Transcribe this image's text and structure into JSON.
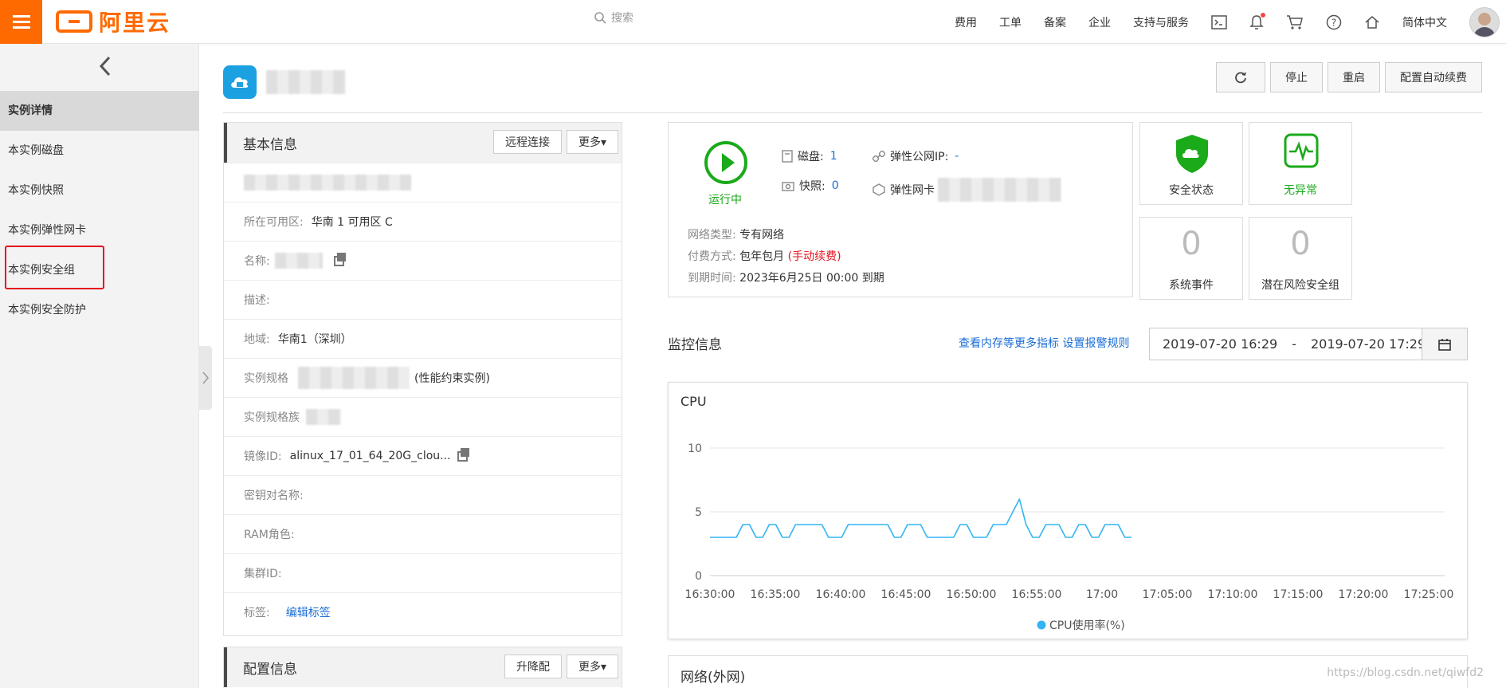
{
  "topbar": {
    "logo_text": "阿里云",
    "search_placeholder": "搜索",
    "nav": [
      "费用",
      "工单",
      "备案",
      "企业",
      "支持与服务"
    ],
    "language": "简体中文"
  },
  "sidebar": {
    "items": [
      {
        "label": "实例详情",
        "active": true
      },
      {
        "label": "本实例磁盘"
      },
      {
        "label": "本实例快照"
      },
      {
        "label": "本实例弹性网卡"
      },
      {
        "label": "本实例安全组"
      },
      {
        "label": "本实例安全防护"
      }
    ]
  },
  "header": {
    "buttons": {
      "stop": "停止",
      "restart": "重启",
      "auto_renew": "配置自动续费"
    }
  },
  "basic": {
    "title": "基本信息",
    "remote": "远程连接",
    "more": "更多▾",
    "zone_label": "所在可用区:",
    "zone": "华南 1 可用区 C",
    "name_label": "名称:",
    "desc_label": "描述:",
    "region_label": "地域:",
    "region": "华南1（深圳）",
    "spec_label": "实例规格",
    "spec_note": "(性能约束实例)",
    "family_label": "实例规格族",
    "image_label": "镜像ID:",
    "image": "alinux_17_01_64_20G_clou...",
    "keypair_label": "密钥对名称:",
    "ram_label": "RAM角色:",
    "cluster_label": "集群ID:",
    "tag_label": "标签:",
    "tag_link": "编辑标签"
  },
  "config": {
    "title": "配置信息",
    "upgrade": "升降配",
    "more": "更多▾"
  },
  "status": {
    "running": "运行中",
    "disk_label": "磁盘:",
    "disk": "1",
    "snapshot_label": "快照:",
    "snapshot": "0",
    "eip_label": "弹性公网IP:",
    "eip": "-",
    "eni_label": "弹性网卡",
    "network_label": "网络类型:",
    "network": "专有网络",
    "billing_label": "付费方式:",
    "billing": "包年包月",
    "billing_note": "(手动续费)",
    "expire_label": "到期时间:",
    "expire": "2023年6月25日 00:00 到期"
  },
  "tiles": {
    "security": "安全状态",
    "no_anomaly": "无异常",
    "events_count": "0",
    "events": "系统事件",
    "risk_count": "0",
    "risk": "潜在风险安全组"
  },
  "monitor": {
    "title": "监控信息",
    "links": "查看内存等更多指标 设置报警规则",
    "range_start": "2019-07-20 16:29",
    "range_sep": "-",
    "range_end": "2019-07-20 17:29",
    "network_title": "网络(外网)"
  },
  "chart_data": {
    "type": "line",
    "title": "CPU",
    "x_ticks": [
      "16:30:00",
      "16:35:00",
      "16:40:00",
      "16:45:00",
      "16:50:00",
      "16:55:00",
      "17:00",
      "17:05:00",
      "17:10:00",
      "17:15:00",
      "17:20:00",
      "17:25:00"
    ],
    "y_ticks": [
      0,
      5,
      10
    ],
    "ylim": [
      0,
      10
    ],
    "series": [
      {
        "name": "CPU使用率(%)",
        "color": "#33b5f4",
        "x": [
          0,
          1,
          2,
          3,
          4,
          5,
          6,
          7,
          8,
          9,
          10,
          11,
          12,
          13,
          14,
          15,
          16,
          17,
          18,
          19,
          20,
          21,
          22,
          23,
          24,
          25,
          26,
          27,
          28,
          29,
          30,
          31,
          32,
          33,
          34,
          35,
          36,
          37,
          38,
          39,
          40,
          41,
          42,
          43,
          44,
          45,
          46,
          47,
          48,
          49,
          50,
          51,
          52,
          53,
          54,
          55,
          56,
          57,
          58,
          59,
          60,
          61,
          62,
          63,
          64
        ],
        "values": [
          3,
          3,
          3,
          3,
          3,
          4,
          4,
          3,
          3,
          4,
          4,
          3,
          3,
          4,
          4,
          4,
          4,
          4,
          3,
          3,
          3,
          4,
          4,
          4,
          4,
          4,
          4,
          4,
          3,
          3,
          4,
          4,
          4,
          3,
          3,
          3,
          3,
          3,
          4,
          4,
          3,
          3,
          3,
          4,
          4,
          4,
          5,
          6,
          4,
          3,
          3,
          4,
          4,
          4,
          3,
          3,
          4,
          4,
          3,
          3,
          4,
          4,
          4,
          3,
          3
        ]
      }
    ],
    "watermark": "https://blog.csdn.net/qiwfd2"
  }
}
